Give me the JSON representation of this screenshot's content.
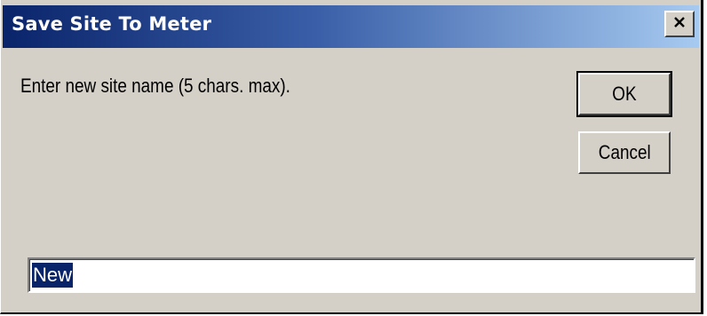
{
  "window": {
    "title": "Save Site To Meter",
    "close_icon": "close-icon"
  },
  "prompt": {
    "text": "Enter new site name (5 chars. max)."
  },
  "buttons": {
    "ok_label": "OK",
    "cancel_label": "Cancel"
  },
  "site_name_field": {
    "value": "New",
    "selected": true
  },
  "colors": {
    "dialog_face": "#d4d0c8",
    "titlebar_start": "#0a246a",
    "titlebar_end": "#a6caf0",
    "selection": "#0a246a"
  }
}
